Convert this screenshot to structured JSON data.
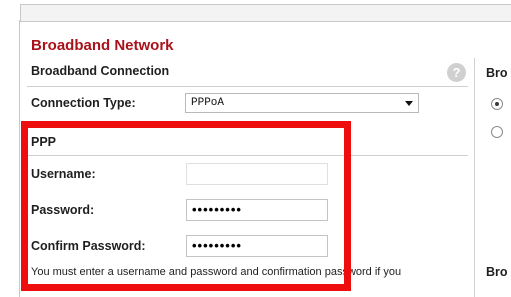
{
  "section": {
    "title": "Broadband Network",
    "subtitle": "Broadband Connection",
    "help_icon": "?"
  },
  "connection": {
    "label": "Connection Type:",
    "value": "PPPoA"
  },
  "ppp": {
    "heading": "PPP",
    "username_label": "Username:",
    "username_value": "",
    "password_label": "Password:",
    "password_value": "•••••••••",
    "confirm_label": "Confirm Password:",
    "confirm_value": "•••••••••",
    "note": "You must enter a username and password and confirmation password if you"
  },
  "right_panel": {
    "heading_top": "Bro",
    "heading_bottom": "Bro"
  },
  "icons": {
    "help": "help-circle-icon",
    "dropdown": "chevron-down-icon"
  },
  "colors": {
    "title_red": "#a8131b",
    "highlight_red": "#ee0e0e"
  }
}
